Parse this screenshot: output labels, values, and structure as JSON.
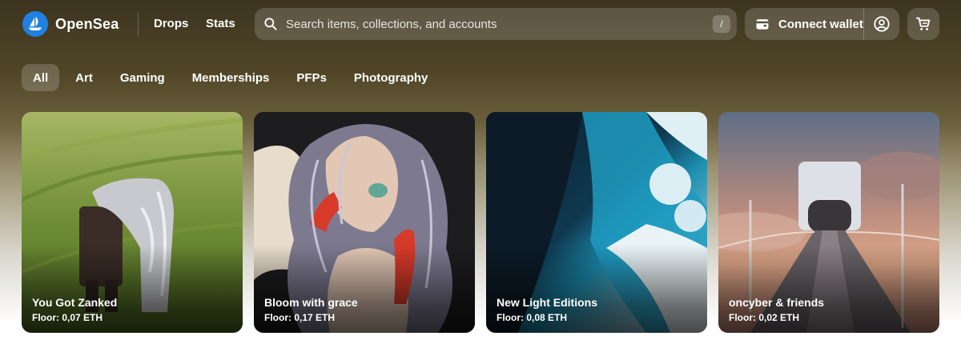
{
  "brand": {
    "name": "OpenSea",
    "accent": "#2081e2"
  },
  "nav": {
    "drops": "Drops",
    "stats": "Stats"
  },
  "search": {
    "placeholder": "Search items, collections, and accounts",
    "shortcut": "/"
  },
  "wallet": {
    "connect_label": "Connect wallet"
  },
  "icons": {
    "search": "search-icon",
    "wallet": "wallet-icon",
    "profile": "profile-icon",
    "cart": "cart-icon",
    "logo": "sailboat-icon"
  },
  "categories": [
    "All",
    "Art",
    "Gaming",
    "Memberships",
    "PFPs",
    "Photography"
  ],
  "active_category": "All",
  "collections": [
    {
      "title": "You Got Zanked",
      "floor": "Floor: 0,07 ETH"
    },
    {
      "title": "Bloom with grace",
      "floor": "Floor: 0,17 ETH"
    },
    {
      "title": "New Light Editions",
      "floor": "Floor: 0,08 ETH"
    },
    {
      "title": "oncyber & friends",
      "floor": "Floor: 0,02 ETH"
    }
  ]
}
